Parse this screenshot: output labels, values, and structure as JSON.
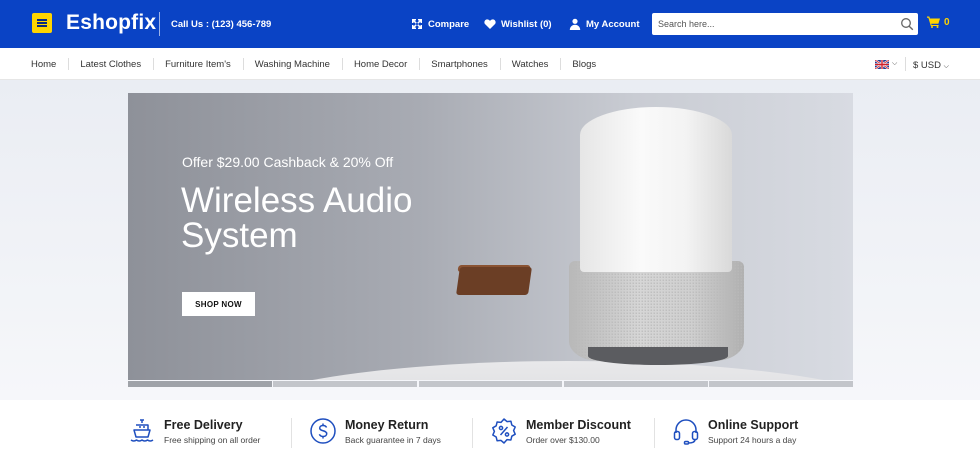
{
  "header": {
    "logo": "Eshopfix",
    "call": "Call Us : (123) 456-789",
    "compare_label": "Compare",
    "wishlist_label": "Wishlist (0)",
    "account_label": "My Account",
    "search_placeholder": "Search here...",
    "cart_count": "0"
  },
  "nav": {
    "items": [
      "Home",
      "Latest Clothes",
      "Furniture Item's",
      "Washing Machine",
      "Home Decor",
      "Smartphones",
      "Watches",
      "Blogs"
    ],
    "currency": "$ USD"
  },
  "hero": {
    "offer": "Offer $29.00 Cashback & 20% Off",
    "headline_1": "Wireless Audio",
    "headline_2": "System",
    "button": "SHOP NOW",
    "slide_count": 5,
    "active_slide": 1
  },
  "features": [
    {
      "title": "Free Delivery",
      "desc": "Free shipping on all order",
      "icon": "ship-icon"
    },
    {
      "title": "Money Return",
      "desc": "Back guarantee in 7 days",
      "icon": "dollar-icon"
    },
    {
      "title": "Member Discount",
      "desc": "Order over $130.00",
      "icon": "discount-badge-icon"
    },
    {
      "title": "Online Support",
      "desc": "Support 24 hours a day",
      "icon": "headset-icon"
    }
  ],
  "colors": {
    "brand": "#0a43c5",
    "accent": "#ffd500",
    "icon": "#1f4fbf"
  }
}
